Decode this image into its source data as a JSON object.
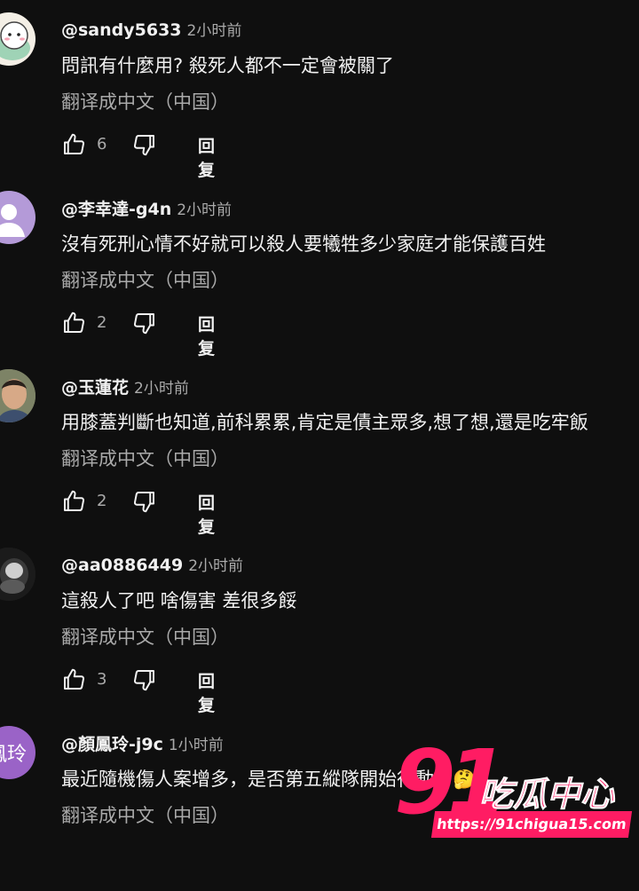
{
  "comments": [
    {
      "author": "@sandy5633",
      "time": "2小时前",
      "text": "問訊有什麼用? 殺死人都不一定會被關了",
      "translate": "翻译成中文（中国）",
      "likes": "6",
      "reply": "回复",
      "avatar": "cartoon"
    },
    {
      "author": "@李幸達-g4n",
      "time": "2小时前",
      "text": "沒有死刑心情不好就可以殺人要犧牲多少家庭才能保護百姓",
      "translate": "翻译成中文（中国）",
      "likes": "2",
      "reply": "回复",
      "avatar": "default"
    },
    {
      "author": "@玉蓮花",
      "time": "2小时前",
      "text": "用膝蓋判斷也知道,前科累累,肯定是債主眾多,想了想,還是吃牢飯",
      "translate": "翻译成中文（中国）",
      "likes": "2",
      "reply": "回复",
      "avatar": "photo"
    },
    {
      "author": "@aa0886449",
      "time": "2小时前",
      "text": "這殺人了吧  啥傷害  差很多餒",
      "translate": "翻译成中文（中国）",
      "likes": "3",
      "reply": "回复",
      "avatar": "dark"
    },
    {
      "author": "@顏鳳玲-j9c",
      "time": "1小时前",
      "text": "最近隨機傷人案增多，是否第五縱隊開始行動了🤔",
      "translate": "翻译成中文（中国）",
      "likes": "",
      "reply": "回复",
      "avatar": "initial",
      "avatar_text": "鳳玲"
    }
  ],
  "watermark": {
    "number": "91",
    "name": "吃瓜中心",
    "url": "https://91chigua15.com"
  }
}
